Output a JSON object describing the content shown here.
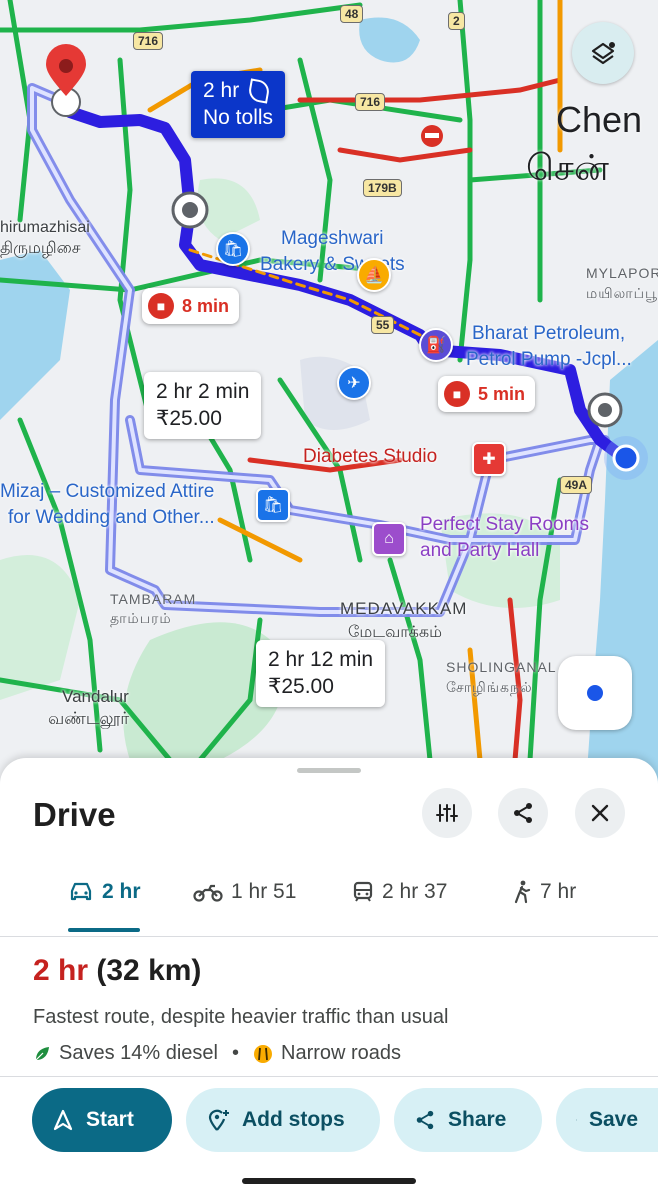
{
  "map": {
    "city_label": "Chen",
    "city_label_tamil": "சென்",
    "place_labels": {
      "thirumazhisai": "hirumazhisai",
      "thirumazhisai_tamil": "திருமழிசை",
      "mylapore": "MYLAPOR",
      "mylapore_tamil": "மயிலாப்பூ",
      "tambaram": "TAMBARAM",
      "tambaram_tamil": "தாம்பரம்",
      "medavakkam": "MEDAVAKKAM",
      "medavakkam_tamil": "மேடவாக்கம்",
      "sholinganallur": "SHOLINGANAL",
      "sholinganallur_tamil": "சோழிங்கநல்",
      "vandalur": "Vandalur",
      "vandalur_tamil": "வண்டலூர்"
    },
    "poi_labels": {
      "bakery_line1": "Mageshwari",
      "bakery_line2": "Bakery & Sweets",
      "petrol_line1": "Bharat Petroleum,",
      "petrol_line2": "Petrol Pump -Jcpl...",
      "diabetes": "Diabetes Studio",
      "mizaj_line1": "Mizaj – Customized Attire",
      "mizaj_line2": "for Wedding and Other...",
      "stay_line1": "Perfect Stay Rooms",
      "stay_line2": "and Party Hall"
    },
    "highway_shields": [
      "716",
      "48",
      "2",
      "716",
      "179B",
      "55",
      "49A"
    ],
    "route_callouts": {
      "primary_time": "2 hr",
      "primary_note": "No tolls",
      "alt1_time": "2 hr 2 min",
      "alt1_toll": "₹25.00",
      "alt2_time": "2 hr 12 min",
      "alt2_toll": "₹25.00"
    },
    "traffic_delays": [
      "8 min",
      "5 min"
    ],
    "colors": {
      "route": "#2d1ee0",
      "alt_route": "#a7b2f7",
      "traffic_red": "#d93025",
      "traffic_green": "#1fb34b",
      "traffic_orange": "#f29900"
    }
  },
  "sheet": {
    "title": "Drive",
    "modes": [
      {
        "icon": "car-icon",
        "label": "2 hr"
      },
      {
        "icon": "motorbike-icon",
        "label": "1 hr 51"
      },
      {
        "icon": "transit-icon",
        "label": "2 hr 37"
      },
      {
        "icon": "walk-icon",
        "label": "7 hr"
      }
    ],
    "summary_time": "2 hr",
    "summary_distance": "(32 km)",
    "description": "Fastest route, despite heavier traffic than usual",
    "eco": "Saves 14% diesel",
    "warning": "Narrow roads",
    "actions": {
      "start": "Start",
      "add_stops": "Add stops",
      "share": "Share",
      "save": "Save"
    }
  }
}
